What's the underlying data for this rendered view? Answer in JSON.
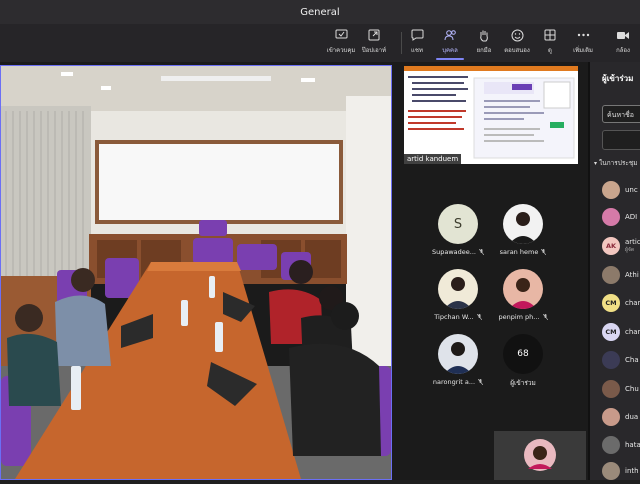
{
  "window": {
    "title": "General"
  },
  "toolbar": {
    "items": [
      {
        "label": "เข้าควบคุม",
        "icon": "cast-icon"
      },
      {
        "label": "ป๊อปเอาท์",
        "icon": "popout-icon"
      },
      {
        "label": "แชท",
        "icon": "chat-icon"
      },
      {
        "label": "บุคคล",
        "icon": "people-icon",
        "active": true
      },
      {
        "label": "ยกมือ",
        "icon": "raise-hand-icon"
      },
      {
        "label": "ตอบสนอง",
        "icon": "react-icon"
      },
      {
        "label": "ดู",
        "icon": "view-icon"
      },
      {
        "label": "เพิ่มเติม",
        "icon": "more-icon"
      },
      {
        "label": "กล้อง",
        "icon": "camera-icon"
      }
    ]
  },
  "shared_screen": {
    "presenter": "artid kanduem"
  },
  "tiles": [
    {
      "name": "Supawadee...",
      "initial": "S",
      "color": "#e2e4d3"
    },
    {
      "name": "saran heme",
      "initial": "",
      "color": "#f2f2f2"
    },
    {
      "name": "Tipchan W...",
      "initial": "",
      "color": "#f0ead8"
    },
    {
      "name": "penpim ph...",
      "initial": "",
      "color": "#e8b7a5"
    },
    {
      "name": "narongrit a...",
      "initial": "",
      "color": "#dfe3ea"
    },
    {
      "name": "ผู้เข้าร่วม",
      "initial": "68",
      "color": "#111111"
    }
  ],
  "panel": {
    "title": "ผู้เข้าร่วม",
    "search_placeholder": "ค้นหาชื่อ",
    "group": "ในการประชุม",
    "participants": [
      {
        "name": "unc",
        "initials": "",
        "color": "#c9a58d",
        "sub": ""
      },
      {
        "name": "ADI",
        "initials": "",
        "color": "#d57aa8",
        "sub": ""
      },
      {
        "name": "artic",
        "initials": "AK",
        "color": "#f2c7c0",
        "sub": "ผู้จัด"
      },
      {
        "name": "Athi",
        "initials": "",
        "color": "#8c7a6a",
        "sub": ""
      },
      {
        "name": "char",
        "initials": "CM",
        "color": "#f0df86",
        "sub": ""
      },
      {
        "name": "char",
        "initials": "CM",
        "color": "#d9d6f2",
        "sub": ""
      },
      {
        "name": "Cha",
        "initials": "",
        "color": "#3b3b55",
        "sub": ""
      },
      {
        "name": "Chu",
        "initials": "",
        "color": "#7a5a4a",
        "sub": ""
      },
      {
        "name": "dua",
        "initials": "",
        "color": "#c89a8a",
        "sub": ""
      },
      {
        "name": "hata",
        "initials": "",
        "color": "#6b6b6b",
        "sub": ""
      },
      {
        "name": "inth",
        "initials": "",
        "color": "#9a8a7a",
        "sub": ""
      }
    ]
  }
}
